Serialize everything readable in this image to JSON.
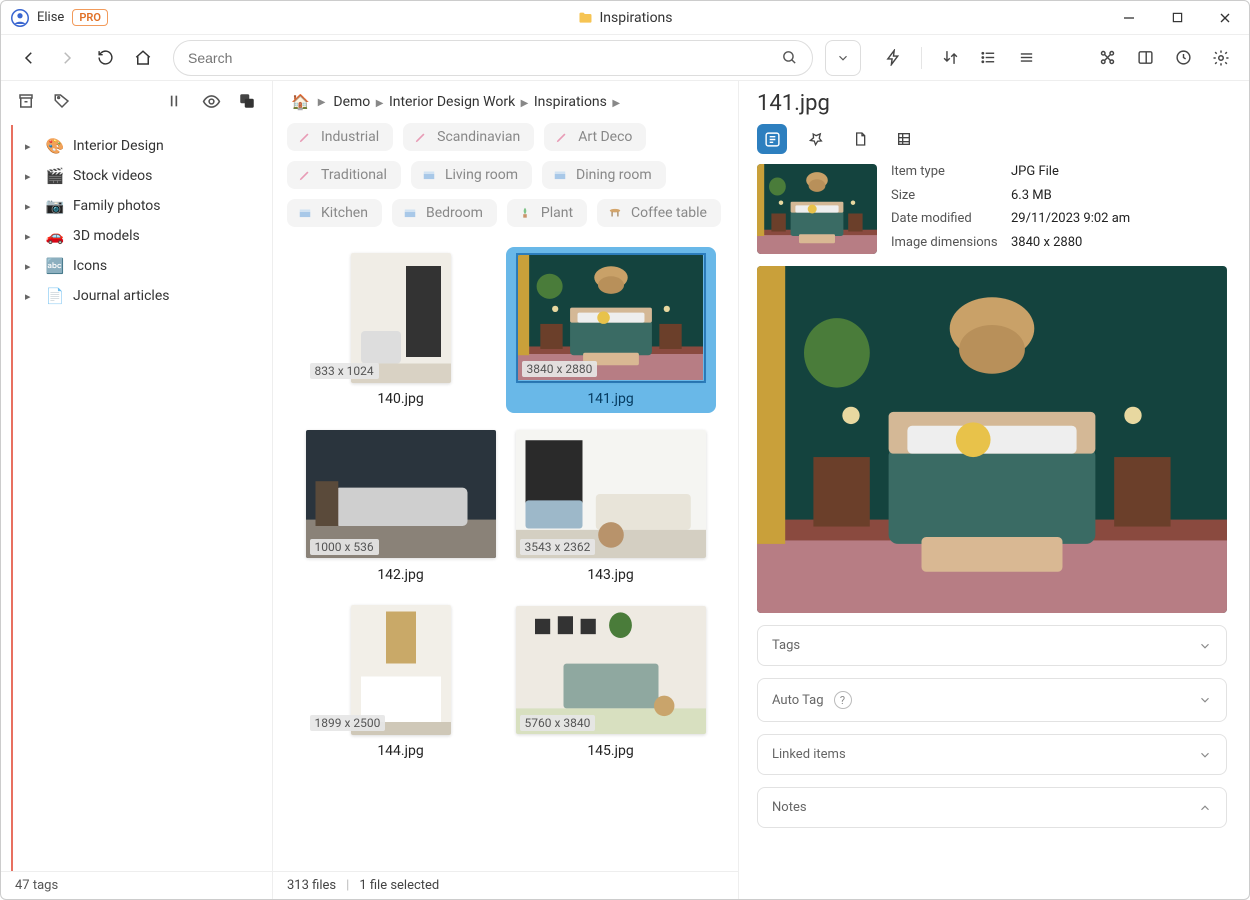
{
  "titlebar": {
    "user": "Elise",
    "badge": "PRO",
    "window_title": "Inspirations"
  },
  "search": {
    "placeholder": "Search",
    "value": ""
  },
  "sidebar": {
    "footer": "47 tags",
    "items": [
      {
        "emoji": "🎨",
        "label": "Interior Design"
      },
      {
        "emoji": "🎬",
        "label": "Stock videos"
      },
      {
        "emoji": "📷",
        "label": "Family photos"
      },
      {
        "emoji": "🚗",
        "label": "3D models"
      },
      {
        "emoji": "🔤",
        "label": "Icons"
      },
      {
        "emoji": "📄",
        "label": "Journal articles"
      }
    ]
  },
  "breadcrumb": [
    "Demo",
    "Interior Design Work",
    "Inspirations"
  ],
  "chips": [
    {
      "ico": "pencil",
      "label": "Industrial"
    },
    {
      "ico": "pencil",
      "label": "Scandinavian"
    },
    {
      "ico": "pencil",
      "label": "Art Deco"
    },
    {
      "ico": "pencil",
      "label": "Traditional"
    },
    {
      "ico": "room",
      "label": "Living room"
    },
    {
      "ico": "room",
      "label": "Dining room"
    },
    {
      "ico": "room",
      "label": "Kitchen"
    },
    {
      "ico": "room",
      "label": "Bedroom"
    },
    {
      "ico": "plant",
      "label": "Plant"
    },
    {
      "ico": "table",
      "label": "Coffee table"
    }
  ],
  "files": [
    {
      "name": "140.jpg",
      "dims": "833 x 1024",
      "selected": false,
      "kind": "light-room"
    },
    {
      "name": "141.jpg",
      "dims": "3840 x 2880",
      "selected": true,
      "kind": "bedroom"
    },
    {
      "name": "142.jpg",
      "dims": "1000 x 536",
      "selected": false,
      "kind": "dark-living"
    },
    {
      "name": "143.jpg",
      "dims": "3543 x 2362",
      "selected": false,
      "kind": "bright-living"
    },
    {
      "name": "144.jpg",
      "dims": "1899 x 2500",
      "selected": false,
      "kind": "kitchen"
    },
    {
      "name": "145.jpg",
      "dims": "5760 x 3840",
      "selected": false,
      "kind": "bed2"
    }
  ],
  "statusbar": {
    "count": "313 files",
    "selection": "1 file selected"
  },
  "details": {
    "title": "141.jpg",
    "meta": {
      "type_lbl": "Item type",
      "type": "JPG File",
      "size_lbl": "Size",
      "size": "6.3 MB",
      "date_lbl": "Date modified",
      "date": "29/11/2023 9:02 am",
      "dims_lbl": "Image dimensions",
      "dims": "3840 x 2880"
    },
    "panels": {
      "tags": "Tags",
      "autotag": "Auto Tag",
      "linked": "Linked items",
      "notes": "Notes"
    }
  }
}
